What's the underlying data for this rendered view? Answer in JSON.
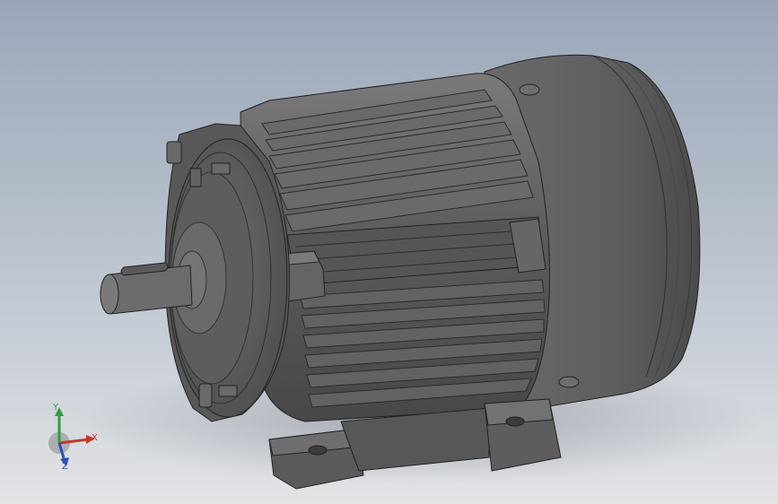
{
  "viewport": {
    "background_top": "#9aa6b8",
    "background_bottom": "#e2e3e5",
    "model_name": "electric-motor"
  },
  "model": {
    "body_color": "#5f5f5f",
    "shadow_color": "#3a3a3a",
    "highlight_color": "#8a8a8a"
  },
  "triad": {
    "x_label": "X",
    "y_label": "Y",
    "z_label": "Z",
    "x_color": "#c0392b",
    "y_color": "#2e9e3b",
    "z_color": "#2b4fb5"
  }
}
